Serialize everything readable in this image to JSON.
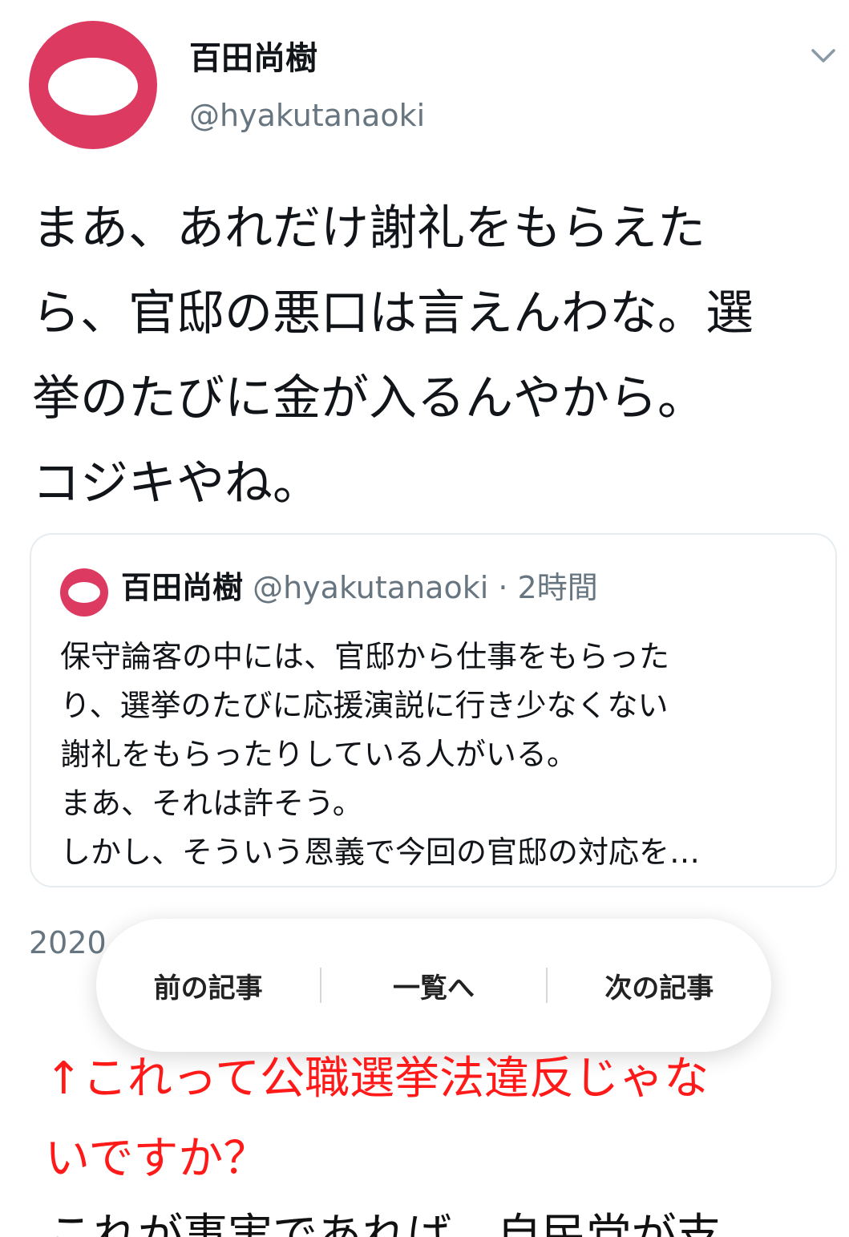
{
  "tweet": {
    "display_name": "百田尚樹",
    "handle": "@hyakutanaoki",
    "body_lines": [
      "まあ、あれだけ謝礼をもらえた",
      "ら、官邸の悪口は言えんわな。選",
      "挙のたびに金が入るんやから。",
      "コジキやね。"
    ],
    "date_partial": "2020"
  },
  "quote": {
    "display_name": "百田尚樹",
    "handle": "@hyakutanaoki",
    "separator": " · ",
    "time": "2時間",
    "body_lines": [
      "保守論客の中には、官邸から仕事をもらった",
      "り、選挙のたびに応援演説に行き少なくない",
      "謝礼をもらったりしている人がいる。",
      "まあ、それは許そう。",
      "しかし、そういう恩義で今回の官邸の対応を…"
    ]
  },
  "nav": {
    "prev_label": "前の記事",
    "list_label": "一覧へ",
    "next_label": "次の記事"
  },
  "article": {
    "red_lines": [
      "↑これって公職選挙法違反じゃな",
      "いですか？"
    ],
    "black_line_partial": "これが事実であれば、自民党が支"
  },
  "colors": {
    "avatar": "#dc3a61",
    "secondary_text": "#66757f",
    "card_border": "#e6ecf0",
    "article_red": "#ff1a1a"
  }
}
